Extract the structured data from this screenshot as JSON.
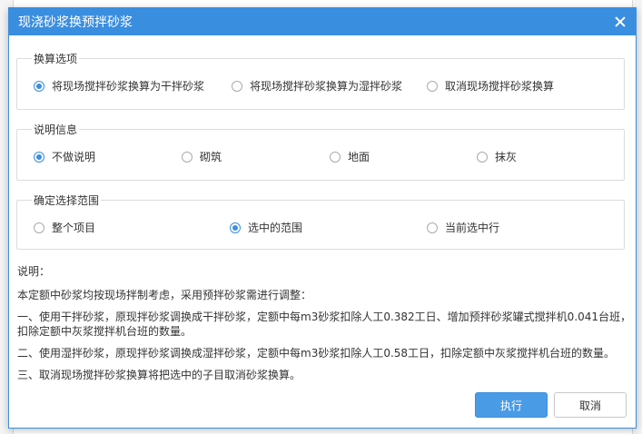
{
  "dialog": {
    "title": "现浇砂浆换预拌砂浆",
    "close_icon": "close-icon"
  },
  "conversion_options": {
    "legend": "换算选项",
    "options": [
      {
        "label": "将现场搅拌砂浆换算为干拌砂浆",
        "checked": true
      },
      {
        "label": "将现场搅拌砂浆换算为湿拌砂浆",
        "checked": false
      },
      {
        "label": "取消现场搅拌砂浆换算",
        "checked": false
      }
    ]
  },
  "description_info": {
    "legend": "说明信息",
    "options": [
      {
        "label": "不做说明",
        "checked": true
      },
      {
        "label": "砌筑",
        "checked": false
      },
      {
        "label": "地面",
        "checked": false
      },
      {
        "label": "抹灰",
        "checked": false
      }
    ]
  },
  "scope": {
    "legend": "确定选择范围",
    "options": [
      {
        "label": "整个项目",
        "checked": false
      },
      {
        "label": "选中的范围",
        "checked": true
      },
      {
        "label": "当前选中行",
        "checked": false
      }
    ]
  },
  "notes": {
    "heading": "说明：",
    "lines": [
      "本定额中砂浆均按现场拌制考虑，采用预拌砂浆需进行调整：",
      "一、使用干拌砂浆，原现拌砂浆调换成干拌砂浆，定额中每m3砂浆扣除人工0.382工日、增加预拌砂浆罐式搅拌机0.041台班，",
      "扣除定额中灰浆搅拌机台班的数量。",
      "二、使用湿拌砂浆，原现拌砂浆调换成湿拌砂浆，定额中每m3砂浆扣除人工0.58工日，扣除定额中灰浆搅拌机台班的数量。",
      "三、取消现场搅拌砂浆换算将把选中的子目取消砂浆换算。"
    ]
  },
  "buttons": {
    "execute": "执行",
    "cancel": "取消"
  },
  "colors": {
    "accent": "#3a8ee0",
    "primary_button": "#4a9be5"
  }
}
